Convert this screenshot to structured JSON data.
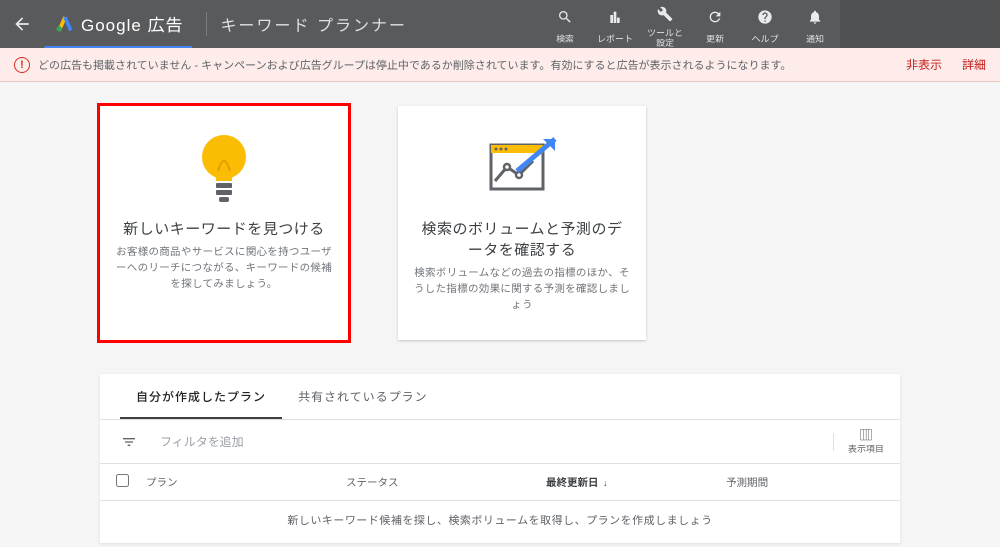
{
  "header": {
    "product": "Google 広告",
    "sub_product": "キーワード プランナー",
    "icons": {
      "search": "検索",
      "report": "レポート",
      "tools": "ツールと\n設定",
      "refresh": "更新",
      "help": "ヘルプ",
      "notifications": "通知"
    }
  },
  "banner": {
    "message": "どの広告も掲載されていません - キャンペーンおよび広告グループは停止中であるか削除されています。有効にすると広告が表示されるようになります。",
    "hide": "非表示",
    "details": "詳細"
  },
  "cards": {
    "discover": {
      "title": "新しいキーワードを見つける",
      "desc": "お客様の商品やサービスに関心を持つユーザーへのリーチにつながる、キーワードの候補を探してみましょう。"
    },
    "forecast": {
      "title": "検索のボリュームと予測のデータを確認する",
      "desc": "検索ボリュームなどの過去の指標のほか、そうした指標の効果に関する予測を確認しましょう"
    }
  },
  "plans": {
    "tabs": {
      "my": "自分が作成したプラン",
      "shared": "共有されているプラン"
    },
    "filter_placeholder": "フィルタを追加",
    "columns_label": "表示項目",
    "thead": {
      "plan": "プラン",
      "status": "ステータス",
      "updated": "最終更新日",
      "period": "予測期間"
    },
    "empty": "新しいキーワード候補を探し、検索ボリュームを取得し、プランを作成しましょう"
  }
}
